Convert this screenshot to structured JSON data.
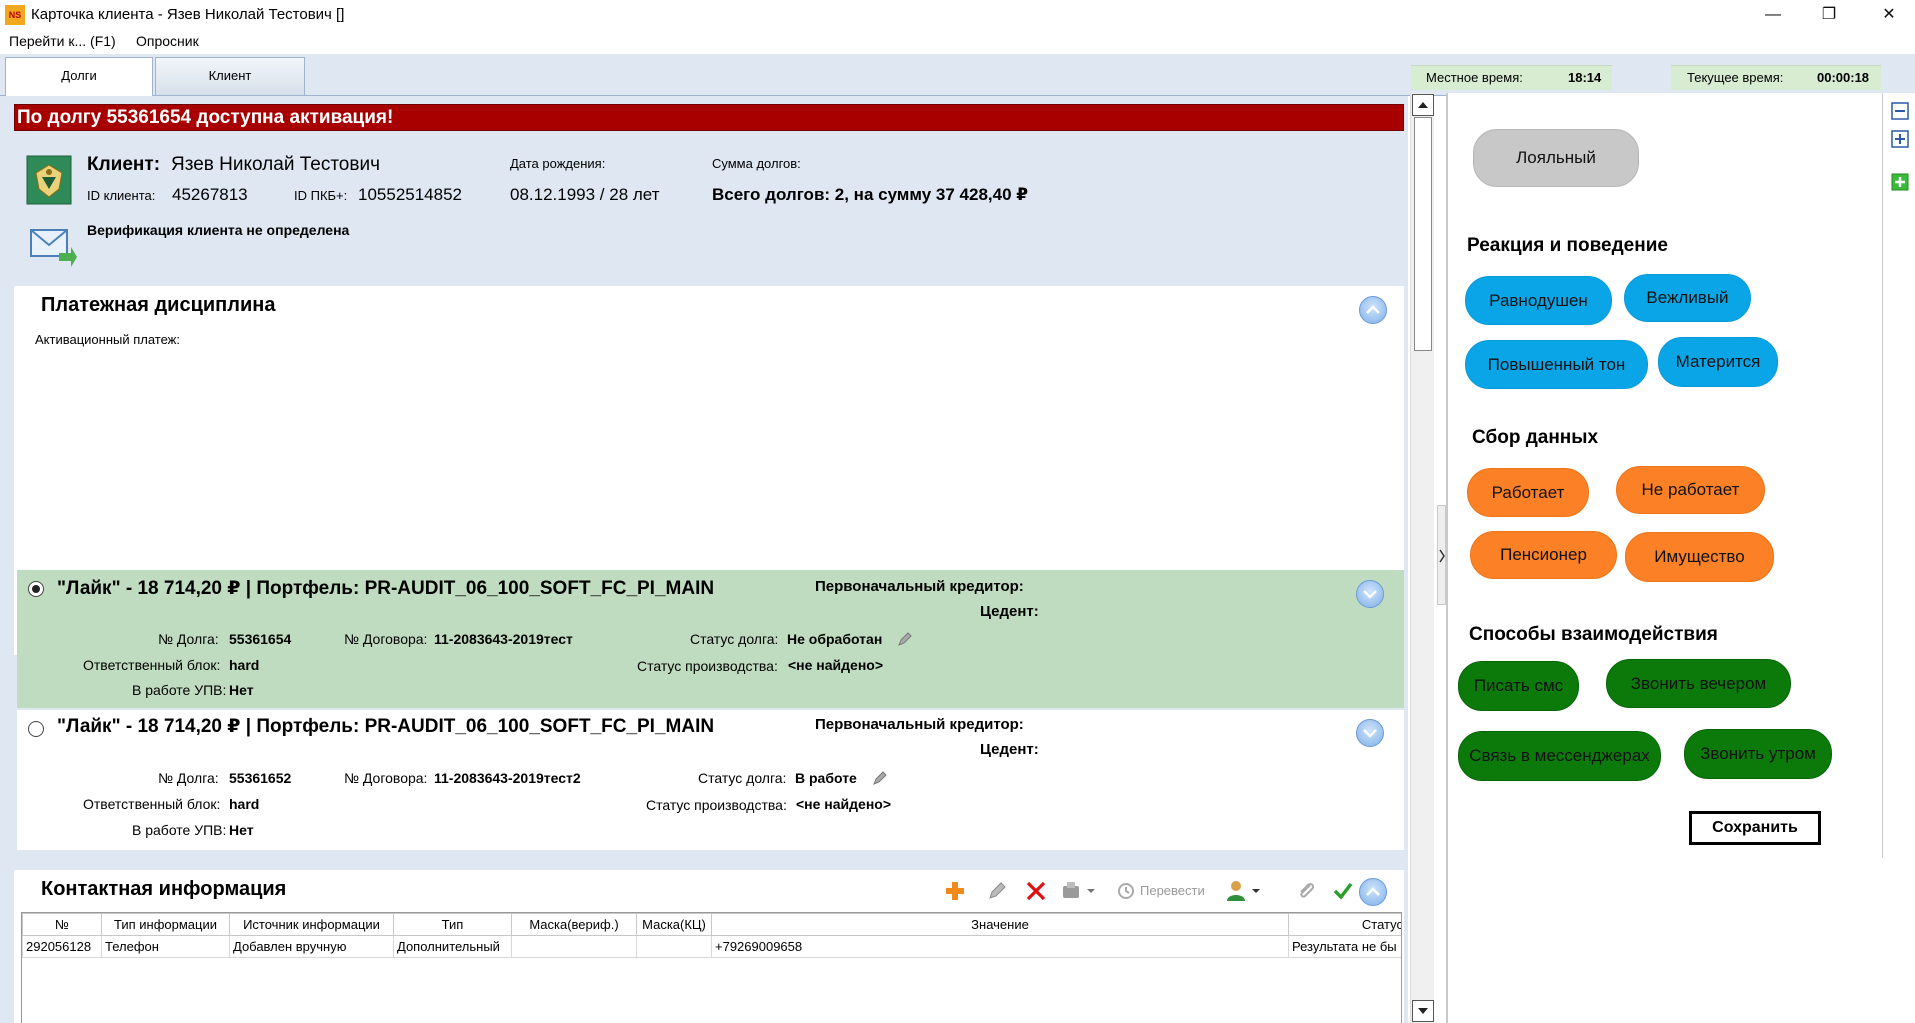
{
  "window": {
    "logo": "NS",
    "title": "Карточка клиента - Язев Николай Тестович []",
    "minimize": "—",
    "maximize": "❐",
    "close": "✕"
  },
  "menu": {
    "goto": "Перейти к... (F1)",
    "survey": "Опросник"
  },
  "tabs": {
    "debts": "Долги",
    "client": "Клиент"
  },
  "time": {
    "local_label": "Местное время:",
    "local_value": "18:14",
    "current_label": "Текущее время:",
    "current_value": "00:00:18"
  },
  "alert": "По долгу 55361654 доступна активация!",
  "client": {
    "name_label": "Клиент:",
    "name": "Язев Николай Тестович",
    "id_label": "ID клиента:",
    "id": "45267813",
    "pkb_label": "ID ПКБ+:",
    "pkb": "10552514852",
    "birth_label": "Дата рождения:",
    "birth": "08.12.1993 / 28 лет",
    "sum_label": "Сумма долгов:",
    "sum": "Всего долгов: 2, на сумму 37 428,40 ₽",
    "verification": "Верификация клиента не определена"
  },
  "payment": {
    "title": "Платежная дисциплина",
    "activation_label": "Активационный платеж:"
  },
  "debts": [
    {
      "head": "\"Лайк\" - 18 714,20 ₽ | Портфель: PR-AUDIT_06_100_SOFT_FC_PI_MAIN",
      "creditor_label": "Первоначальный кредитор:",
      "cedent_label": "Цедент:",
      "debt_no_label": "№ Долга:",
      "debt_no": "55361654",
      "contract_label": "№ Договора:",
      "contract": "11-2083643-2019тест",
      "status_label": "Статус долга:",
      "status": "Не обработан",
      "block_label": "Ответственный блок:",
      "block": "hard",
      "prod_label": "Статус производства:",
      "prod": "<не найдено>",
      "upv_label": "В работе УПВ:",
      "upv": "Нет"
    },
    {
      "head": "\"Лайк\" - 18 714,20 ₽ | Портфель: PR-AUDIT_06_100_SOFT_FC_PI_MAIN",
      "creditor_label": "Первоначальный кредитор:",
      "cedent_label": "Цедент:",
      "debt_no_label": "№ Долга:",
      "debt_no": "55361652",
      "contract_label": "№ Договора:",
      "contract": "11-2083643-2019тест2",
      "status_label": "Статус долга:",
      "status": "В работе",
      "block_label": "Ответственный блок:",
      "block": "hard",
      "prod_label": "Статус производства:",
      "prod": "<не найдено>",
      "upv_label": "В работе УПВ:",
      "upv": "Нет"
    }
  ],
  "contacts": {
    "title": "Контактная информация",
    "translate": "Перевести",
    "columns": [
      "№",
      "Тип информации",
      "Источник информации",
      "Тип",
      "Маска(вериф.)",
      "Маска(КЦ)",
      "Значение",
      "Статус"
    ],
    "rows": [
      [
        "292056128",
        "Телефон",
        "Добавлен вручную",
        "Дополнительный",
        "",
        "",
        "+79269009658",
        "Результата не бы"
      ]
    ]
  },
  "survey": {
    "loyal": "Лояльный",
    "reaction_title": "Реакция и поведение",
    "reaction": [
      "Равнодушен",
      "Вежливый",
      "Повышенный тон",
      "Матерится"
    ],
    "data_title": "Сбор данных",
    "data": [
      "Работает",
      "Не работает",
      "Пенсионер",
      "Имущество"
    ],
    "interaction_title": "Способы взаимодействия",
    "interaction": [
      "Писать смс",
      "Звонить вечером",
      "Связь в мессенджерах",
      "Звонить утром"
    ],
    "save": "Сохранить"
  },
  "colors": {
    "alert": "#a80000",
    "debt_selected": "#c0dcc0",
    "blue_pill": "#0aa5e6",
    "orange_pill": "#fb8026",
    "green_pill": "#0b7a0b"
  }
}
